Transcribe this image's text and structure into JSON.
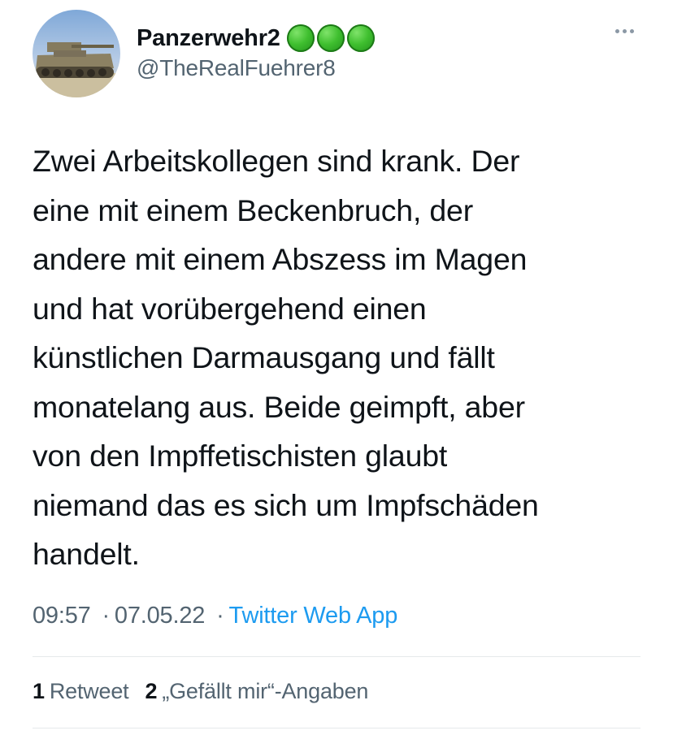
{
  "author": {
    "display_name": "Panzerwehr2",
    "handle": "@TheRealFuehrer8",
    "avatar": "tank-avatar",
    "badges": [
      "green-circle-icon",
      "green-circle-icon",
      "green-circle-icon"
    ]
  },
  "tweet": {
    "text": "Zwei Arbeitskollegen sind krank. Der\neine mit einem Beckenbruch, der\nandere mit einem Abszess im Magen\nund hat vorübergehend einen\nkünstlichen Darmausgang und fällt\nmonatelang aus. Beide geimpft, aber\nvon den Impffetischisten glaubt\nniemand das es sich um Impfschäden\nhandelt.",
    "time": "09:57",
    "date": "07.05.22",
    "separator": "·",
    "source": "Twitter Web App"
  },
  "stats": {
    "retweets_count": "1",
    "retweets_label": "Retweet",
    "likes_count": "2",
    "likes_label": "„Gefällt mir“-Angaben"
  },
  "colors": {
    "text": "#0f1419",
    "secondary": "#536471",
    "link": "#1d9bf0",
    "badge": "#3fbf2f"
  }
}
